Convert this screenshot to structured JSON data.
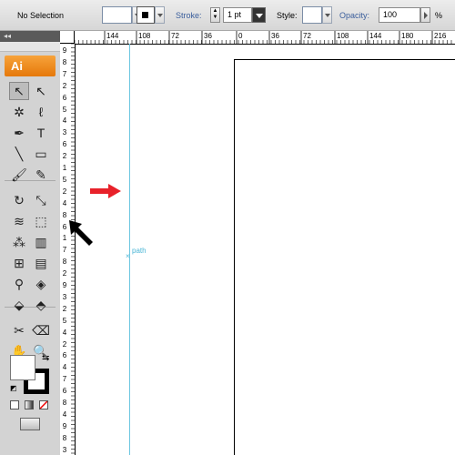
{
  "control_bar": {
    "selection_label": "No Selection",
    "stroke_label": "Stroke:",
    "stroke_weight": "1 pt",
    "style_label": "Style:",
    "opacity_label": "Opacity:",
    "opacity_value": "100",
    "percent_sign": "%"
  },
  "tools_panel": {
    "collapse_glyph": "◂◂",
    "logo": "Ai",
    "tools": [
      {
        "name": "selection-tool-icon",
        "glyph": "↖",
        "active": true
      },
      {
        "name": "direct-selection-tool-icon",
        "glyph": "↖"
      },
      {
        "name": "magic-wand-tool-icon",
        "glyph": "✲"
      },
      {
        "name": "lasso-tool-icon",
        "glyph": "ℓ"
      },
      {
        "name": "pen-tool-icon",
        "glyph": "✒"
      },
      {
        "name": "type-tool-icon",
        "glyph": "T"
      },
      {
        "name": "line-segment-tool-icon",
        "glyph": "╲"
      },
      {
        "name": "rectangle-tool-icon",
        "glyph": "▭"
      },
      {
        "name": "paintbrush-tool-icon",
        "glyph": "🖌"
      },
      {
        "name": "pencil-tool-icon",
        "glyph": "✎"
      },
      {
        "name": "rotate-tool-icon",
        "glyph": "↻"
      },
      {
        "name": "scale-tool-icon",
        "glyph": "⤡"
      },
      {
        "name": "warp-tool-icon",
        "glyph": "≋"
      },
      {
        "name": "free-transform-tool-icon",
        "glyph": "⬚"
      },
      {
        "name": "symbol-sprayer-tool-icon",
        "glyph": "⁂"
      },
      {
        "name": "column-graph-tool-icon",
        "glyph": "▥"
      },
      {
        "name": "mesh-tool-icon",
        "glyph": "⊞"
      },
      {
        "name": "gradient-tool-icon",
        "glyph": "▤"
      },
      {
        "name": "eyedropper-tool-icon",
        "glyph": "⚲"
      },
      {
        "name": "blend-tool-icon",
        "glyph": "◈"
      },
      {
        "name": "live-paint-bucket-tool-icon",
        "glyph": "⬙"
      },
      {
        "name": "live-paint-selection-tool-icon",
        "glyph": "⬘"
      },
      {
        "name": "slice-tool-icon",
        "glyph": "✂"
      },
      {
        "name": "eraser-tool-icon",
        "glyph": "⌫"
      },
      {
        "name": "hand-tool-icon",
        "glyph": "✋"
      },
      {
        "name": "zoom-tool-icon",
        "glyph": "🔍"
      }
    ],
    "swap_glyph": "⇆",
    "default_glyph": "◩"
  },
  "rulers": {
    "horizontal_labels": [
      "144",
      "108",
      "72",
      "36",
      "0",
      "36",
      "72",
      "108",
      "144",
      "180",
      "216"
    ],
    "vertical_labels": [
      "9",
      "8",
      "7",
      "2",
      "6",
      "5",
      "4",
      "3",
      "6",
      "2",
      "1",
      "5",
      "2",
      "4",
      "8",
      "6",
      "1",
      "7",
      "8",
      "2",
      "9",
      "3",
      "2",
      "5",
      "4",
      "2",
      "6",
      "4",
      "7",
      "6",
      "8",
      "4",
      "9",
      "8",
      "3"
    ]
  },
  "canvas": {
    "guide_label": "path",
    "guide_marker": "×"
  },
  "colors": {
    "accent_logo": "#e5780b",
    "guide": "#6cc6e0",
    "link_label": "#3a5e9c",
    "red_arrow": "#e8212a",
    "black_arrow": "#000000"
  }
}
